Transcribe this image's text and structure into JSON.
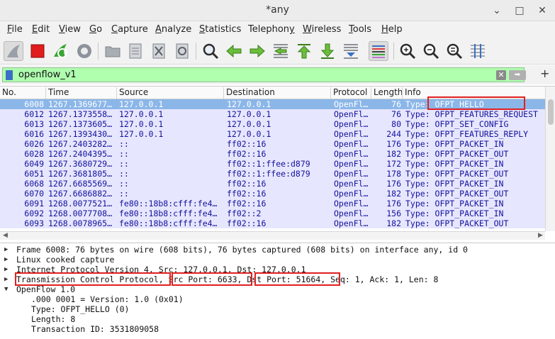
{
  "window": {
    "title": "*any",
    "minimize": "⌄",
    "maximize": "□",
    "close": "✕"
  },
  "menu": [
    {
      "key": "F",
      "rest": "ile"
    },
    {
      "key": "E",
      "rest": "dit"
    },
    {
      "key": "V",
      "rest": "iew"
    },
    {
      "key": "G",
      "rest": "o"
    },
    {
      "key": "C",
      "rest": "apture"
    },
    {
      "key": "A",
      "rest": "nalyze"
    },
    {
      "key": "S",
      "rest": "tatistics"
    },
    {
      "key": "",
      "rest": "Telephon",
      "key2": "y"
    },
    {
      "key": "W",
      "rest": "ireless"
    },
    {
      "key": "T",
      "rest": "ools"
    },
    {
      "key": "H",
      "rest": "elp"
    }
  ],
  "toolbar_icons": [
    "shark-fin-icon",
    "stop-capture-icon",
    "restart-capture-icon",
    "capture-options-icon",
    "open-file-icon",
    "save-file-icon",
    "close-file-icon",
    "reload-file-icon",
    "find-packet-icon",
    "go-back-icon",
    "go-forward-icon",
    "go-to-packet-icon",
    "go-first-icon",
    "go-last-icon",
    "autoscroll-icon",
    "colorize-icon",
    "zoom-in-icon",
    "zoom-out-icon",
    "zoom-normal-icon",
    "resize-columns-icon"
  ],
  "filter": {
    "value": "openflow_v1",
    "clear": "✕",
    "apply": "➡",
    "add": "+"
  },
  "columns": [
    "No.",
    "Time",
    "Source",
    "Destination",
    "Protocol",
    "Length",
    "Info"
  ],
  "packets": [
    {
      "no": "6008",
      "time": "1267.1369677…",
      "src": "127.0.0.1",
      "dst": "127.0.0.1",
      "proto": "OpenFl…",
      "len": "76",
      "info": "Type: OFPT_HELLO",
      "selected": true
    },
    {
      "no": "6012",
      "time": "1267.1373558…",
      "src": "127.0.0.1",
      "dst": "127.0.0.1",
      "proto": "OpenFl…",
      "len": "76",
      "info": "Type: OFPT_FEATURES_REQUEST"
    },
    {
      "no": "6013",
      "time": "1267.1373605…",
      "src": "127.0.0.1",
      "dst": "127.0.0.1",
      "proto": "OpenFl…",
      "len": "80",
      "info": "Type: OFPT_SET_CONFIG"
    },
    {
      "no": "6016",
      "time": "1267.1393430…",
      "src": "127.0.0.1",
      "dst": "127.0.0.1",
      "proto": "OpenFl…",
      "len": "244",
      "info": "Type: OFPT_FEATURES_REPLY"
    },
    {
      "no": "6026",
      "time": "1267.2403282…",
      "src": "::",
      "dst": "ff02::16",
      "proto": "OpenFl…",
      "len": "176",
      "info": "Type: OFPT_PACKET_IN"
    },
    {
      "no": "6028",
      "time": "1267.2404395…",
      "src": "::",
      "dst": "ff02::16",
      "proto": "OpenFl…",
      "len": "182",
      "info": "Type: OFPT_PACKET_OUT"
    },
    {
      "no": "6049",
      "time": "1267.3680729…",
      "src": "::",
      "dst": "ff02::1:ffee:d879",
      "proto": "OpenFl…",
      "len": "172",
      "info": "Type: OFPT_PACKET_IN"
    },
    {
      "no": "6051",
      "time": "1267.3681805…",
      "src": "::",
      "dst": "ff02::1:ffee:d879",
      "proto": "OpenFl…",
      "len": "178",
      "info": "Type: OFPT_PACKET_OUT"
    },
    {
      "no": "6068",
      "time": "1267.6685569…",
      "src": "::",
      "dst": "ff02::16",
      "proto": "OpenFl…",
      "len": "176",
      "info": "Type: OFPT_PACKET_IN"
    },
    {
      "no": "6070",
      "time": "1267.6686882…",
      "src": "::",
      "dst": "ff02::16",
      "proto": "OpenFl…",
      "len": "182",
      "info": "Type: OFPT_PACKET_OUT"
    },
    {
      "no": "6091",
      "time": "1268.0077521…",
      "src": "fe80::18b8:cfff:fe4…",
      "dst": "ff02::16",
      "proto": "OpenFl…",
      "len": "176",
      "info": "Type: OFPT_PACKET_IN"
    },
    {
      "no": "6092",
      "time": "1268.0077708…",
      "src": "fe80::18b8:cfff:fe4…",
      "dst": "ff02::2",
      "proto": "OpenFl…",
      "len": "156",
      "info": "Type: OFPT_PACKET_IN"
    },
    {
      "no": "6093",
      "time": "1268.0078965…",
      "src": "fe80::18b8:cfff:fe4…",
      "dst": "ff02::16",
      "proto": "OpenFl…",
      "len": "182",
      "info": "Type: OFPT_PACKET_OUT"
    }
  ],
  "details": [
    {
      "twisty": "▶",
      "text": "Frame 6008: 76 bytes on wire (608 bits), 76 bytes captured (608 bits) on interface any, id 0"
    },
    {
      "twisty": "▶",
      "text": "Linux cooked capture"
    },
    {
      "twisty": "▶",
      "text": "Internet Protocol Version 4, Src: 127.0.0.1, Dst: 127.0.0.1"
    },
    {
      "twisty": "▶",
      "text": "Transmission Control Protocol, Src Port: 6633, Dst Port: 51664, Seq: 1, Ack: 1, Len: 8"
    },
    {
      "twisty": "▼",
      "text": "OpenFlow 1.0"
    },
    {
      "twisty": "",
      "text": ".000 0001 = Version: 1.0 (0x01)"
    },
    {
      "twisty": "",
      "text": "Type: OFPT_HELLO (0)"
    },
    {
      "twisty": "",
      "text": "Length: 8"
    },
    {
      "twisty": "",
      "text": "Transaction ID: 3531809058"
    }
  ],
  "colors": {
    "row_bg": "#e7e6ff",
    "row_selected": "#8bb6e8",
    "filter_valid": "#afffaf",
    "highlight": "#e02020"
  }
}
